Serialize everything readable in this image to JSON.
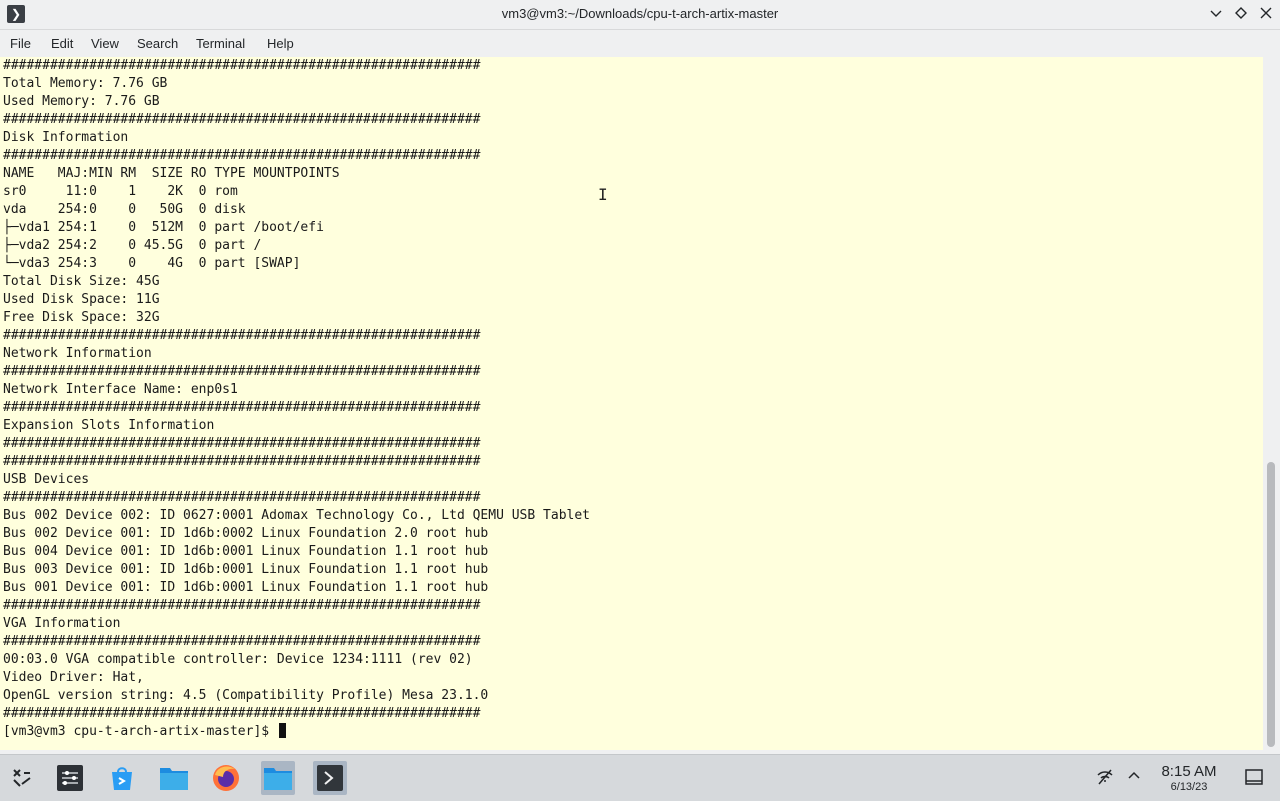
{
  "window": {
    "title": "vm3@vm3:~/Downloads/cpu-t-arch-artix-master",
    "app_icon": "terminal-icon",
    "buttons": [
      "chevron-down-icon",
      "diamond-icon",
      "close-icon"
    ]
  },
  "menu": {
    "file": "File",
    "edit": "Edit",
    "view": "View",
    "search": "Search",
    "terminal": "Terminal",
    "help": "Help"
  },
  "terminal": {
    "lines": [
      "#############################################################",
      "Total Memory: 7.76 GB",
      "Used Memory: 7.76 GB",
      "#############################################################",
      "Disk Information",
      "#############################################################",
      "NAME   MAJ:MIN RM  SIZE RO TYPE MOUNTPOINTS",
      "sr0     11:0    1    2K  0 rom",
      "vda    254:0    0   50G  0 disk",
      "├─vda1 254:1    0  512M  0 part /boot/efi",
      "├─vda2 254:2    0 45.5G  0 part /",
      "└─vda3 254:3    0    4G  0 part [SWAP]",
      "Total Disk Size: 45G",
      "Used Disk Space: 11G",
      "Free Disk Space: 32G",
      "#############################################################",
      "Network Information",
      "#############################################################",
      "Network Interface Name: enp0s1",
      "#############################################################",
      "Expansion Slots Information",
      "#############################################################",
      "#############################################################",
      "USB Devices",
      "#############################################################",
      "Bus 002 Device 002: ID 0627:0001 Adomax Technology Co., Ltd QEMU USB Tablet",
      "Bus 002 Device 001: ID 1d6b:0002 Linux Foundation 2.0 root hub",
      "Bus 004 Device 001: ID 1d6b:0001 Linux Foundation 1.1 root hub",
      "Bus 003 Device 001: ID 1d6b:0001 Linux Foundation 1.1 root hub",
      "Bus 001 Device 001: ID 1d6b:0001 Linux Foundation 1.1 root hub",
      "#############################################################",
      "VGA Information",
      "#############################################################",
      "00:03.0 VGA compatible controller: Device 1234:1111 (rev 02)",
      "Video Driver: Hat,",
      "OpenGL version string: 4.5 (Compatibility Profile) Mesa 23.1.0",
      "#############################################################"
    ],
    "prompt": "[vm3@vm3 cpu-t-arch-artix-master]$ ",
    "background": "#ffffdd"
  },
  "taskbar": {
    "items": [
      {
        "icon": "app-launcher-icon"
      },
      {
        "icon": "system-settings-icon"
      },
      {
        "icon": "software-store-icon"
      },
      {
        "icon": "file-manager-icon"
      },
      {
        "icon": "firefox-icon"
      },
      {
        "icon": "folder-icon",
        "active": true
      },
      {
        "icon": "terminal-icon",
        "active": true
      }
    ],
    "clock_time": "8:15 AM",
    "clock_date": "6/13/23"
  }
}
